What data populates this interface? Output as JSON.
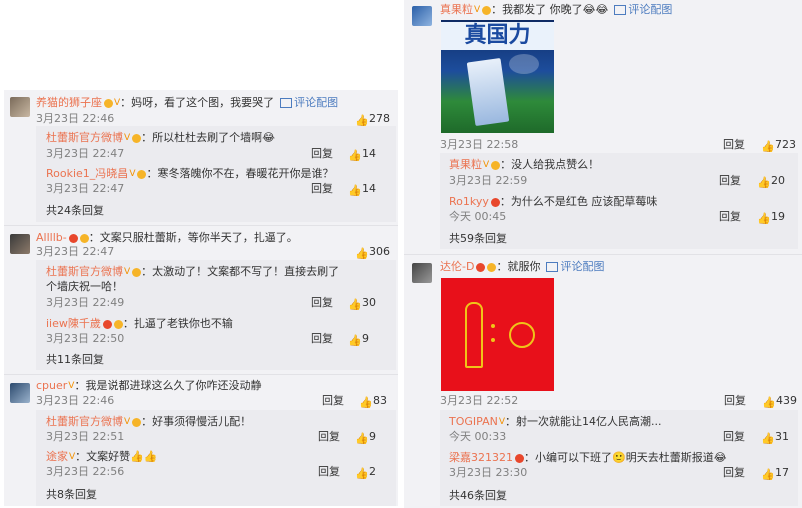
{
  "left": {
    "threads": [
      {
        "comment": {
          "user": "养猫的狮子座",
          "text": "：妈呀，看了这个图，我要哭了",
          "pic_label": "评论配图",
          "date": "3月23日 22:46",
          "likes": "278"
        },
        "replies": [
          {
            "user": "杜蕾斯官方微博",
            "text": "：所以杜杜去刷了个墙啊😂",
            "date": "3月23日 22:47",
            "reply": "回复",
            "likes": "14"
          },
          {
            "user": "Rookie1_冯晓昌",
            "text": "：寒冬落魄你不在，春暖花开你是谁？",
            "date": "3月23日 22:47",
            "reply": "回复",
            "likes": "14"
          }
        ],
        "more": "共24条回复"
      },
      {
        "comment": {
          "user": "Allllb-",
          "text": "：文案只服杜蕾斯，等你半天了，扎逼了。",
          "date": "3月23日 22:47",
          "likes": "306"
        },
        "replies": [
          {
            "user": "杜蕾斯官方微博",
            "text": "：太激动了！文案都不写了！直接去刷了",
            "text2": "个墙庆祝一哈！",
            "date": "3月23日 22:49",
            "reply": "回复",
            "likes": "30"
          },
          {
            "user": "iiew陳千歲",
            "text": "：扎逼了老铁你也不输",
            "date": "3月23日 22:50",
            "reply": "回复",
            "likes": "9"
          }
        ],
        "more": "共11条回复"
      },
      {
        "comment": {
          "user": "cpuer",
          "text": "：我是说都进球这么久了你咋还没动静",
          "date": "3月23日 22:46",
          "reply": "回复",
          "likes": "83"
        },
        "replies": [
          {
            "user": "杜蕾斯官方微博",
            "text": "：好事须得慢活儿配！",
            "date": "3月23日 22:51",
            "reply": "回复",
            "likes": "9"
          },
          {
            "user": "途家",
            "text": "：文案好赞👍👍",
            "date": "3月23日 22:56",
            "reply": "回复",
            "likes": "2"
          }
        ],
        "more": "共8条回复"
      }
    ]
  },
  "right": {
    "threads": [
      {
        "comment": {
          "user": "真果粒",
          "text": "：我都发了 你晚了😂😂",
          "pic_label": "评论配图",
          "image_text": "真国力",
          "date": "3月23日 22:58",
          "reply": "回复",
          "likes": "723"
        },
        "replies": [
          {
            "user": "真果粒",
            "text": "：没人给我点赞么！",
            "date": "3月23日 22:59",
            "reply": "回复",
            "likes": "20"
          },
          {
            "user": "Ro1kyy",
            "text": "：为什么不是红色 应该配草莓味",
            "date": "今天 00:45",
            "reply": "回复",
            "likes": "19"
          }
        ],
        "more": "共59条回复"
      },
      {
        "comment": {
          "user": "达伦-D",
          "text": "：就服你",
          "pic_label": "评论配图",
          "date": "3月23日 22:52",
          "reply": "回复",
          "likes": "439"
        },
        "replies": [
          {
            "user": "TOGIPAN",
            "text": "：射一次就能让14亿人民高潮...",
            "date": "今天 00:33",
            "reply": "回复",
            "likes": "31"
          },
          {
            "user": "梁嘉321321",
            "text": "：小编可以下班了🙂明天去杜蕾斯报道😂",
            "date": "3月23日 23:30",
            "reply": "回复",
            "likes": "17"
          }
        ],
        "more": "共46条回复"
      }
    ]
  },
  "colors": {
    "panel": "#f2f2f5",
    "link": "#eb7350",
    "accent_blue": "#4d7cbf",
    "red_image": "#e8101a",
    "gold": "#f0c419"
  }
}
